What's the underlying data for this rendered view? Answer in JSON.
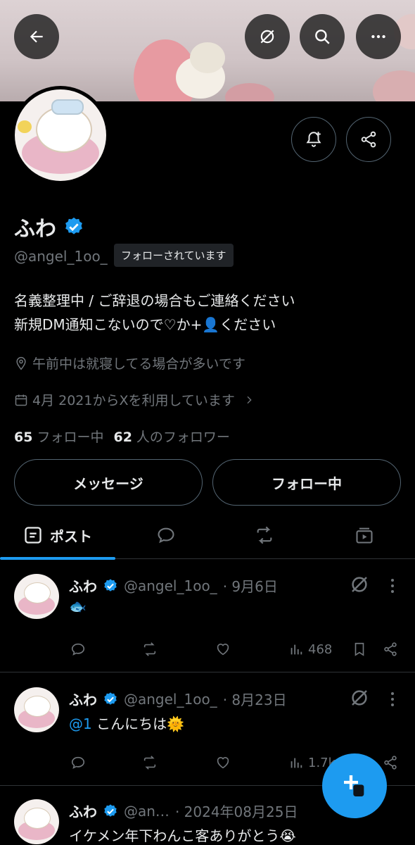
{
  "header": {
    "back_icon": "arrow-left-icon",
    "grok_icon": "grok-icon",
    "search_icon": "search-icon",
    "more_icon": "more-horizontal-icon"
  },
  "profile": {
    "name": "ふわ",
    "handle": "@angel_1oo_",
    "follows_you": "フォローされています",
    "bio_line1": "名義整理中 / ご辞退の場合もご連絡ください",
    "bio_line2": "新規DM通知こないので♡か+👤ください",
    "location": "午前中は就寝してる場合が多いです",
    "joined": "4月 2021からXを利用しています",
    "following_count": "65",
    "following_label": "フォロー中",
    "followers_count": "62",
    "followers_label": "人のフォロワー",
    "message_button": "メッセージ",
    "following_button": "フォロー中",
    "accent": "#1d9bf0"
  },
  "tabs": [
    {
      "label": "ポスト",
      "icon": "posts-icon",
      "active": true
    },
    {
      "label": "",
      "icon": "reply-icon"
    },
    {
      "label": "",
      "icon": "repost-icon"
    },
    {
      "label": "",
      "icon": "media-icon"
    }
  ],
  "posts": [
    {
      "name": "ふわ",
      "handle": "@angel_1oo_",
      "date": "· 9月6日",
      "text": "🐟",
      "views": "468"
    },
    {
      "name": "ふわ",
      "handle": "@angel_1oo_",
      "date": "· 8月23日",
      "mention": "@1",
      "text": " こんにちは🌞",
      "views": "1.7k"
    },
    {
      "name": "ふわ",
      "handle": "@an…",
      "date": "· 2024年08月25日",
      "text": "イケメン年下わんこ客ありがとう😭"
    }
  ]
}
